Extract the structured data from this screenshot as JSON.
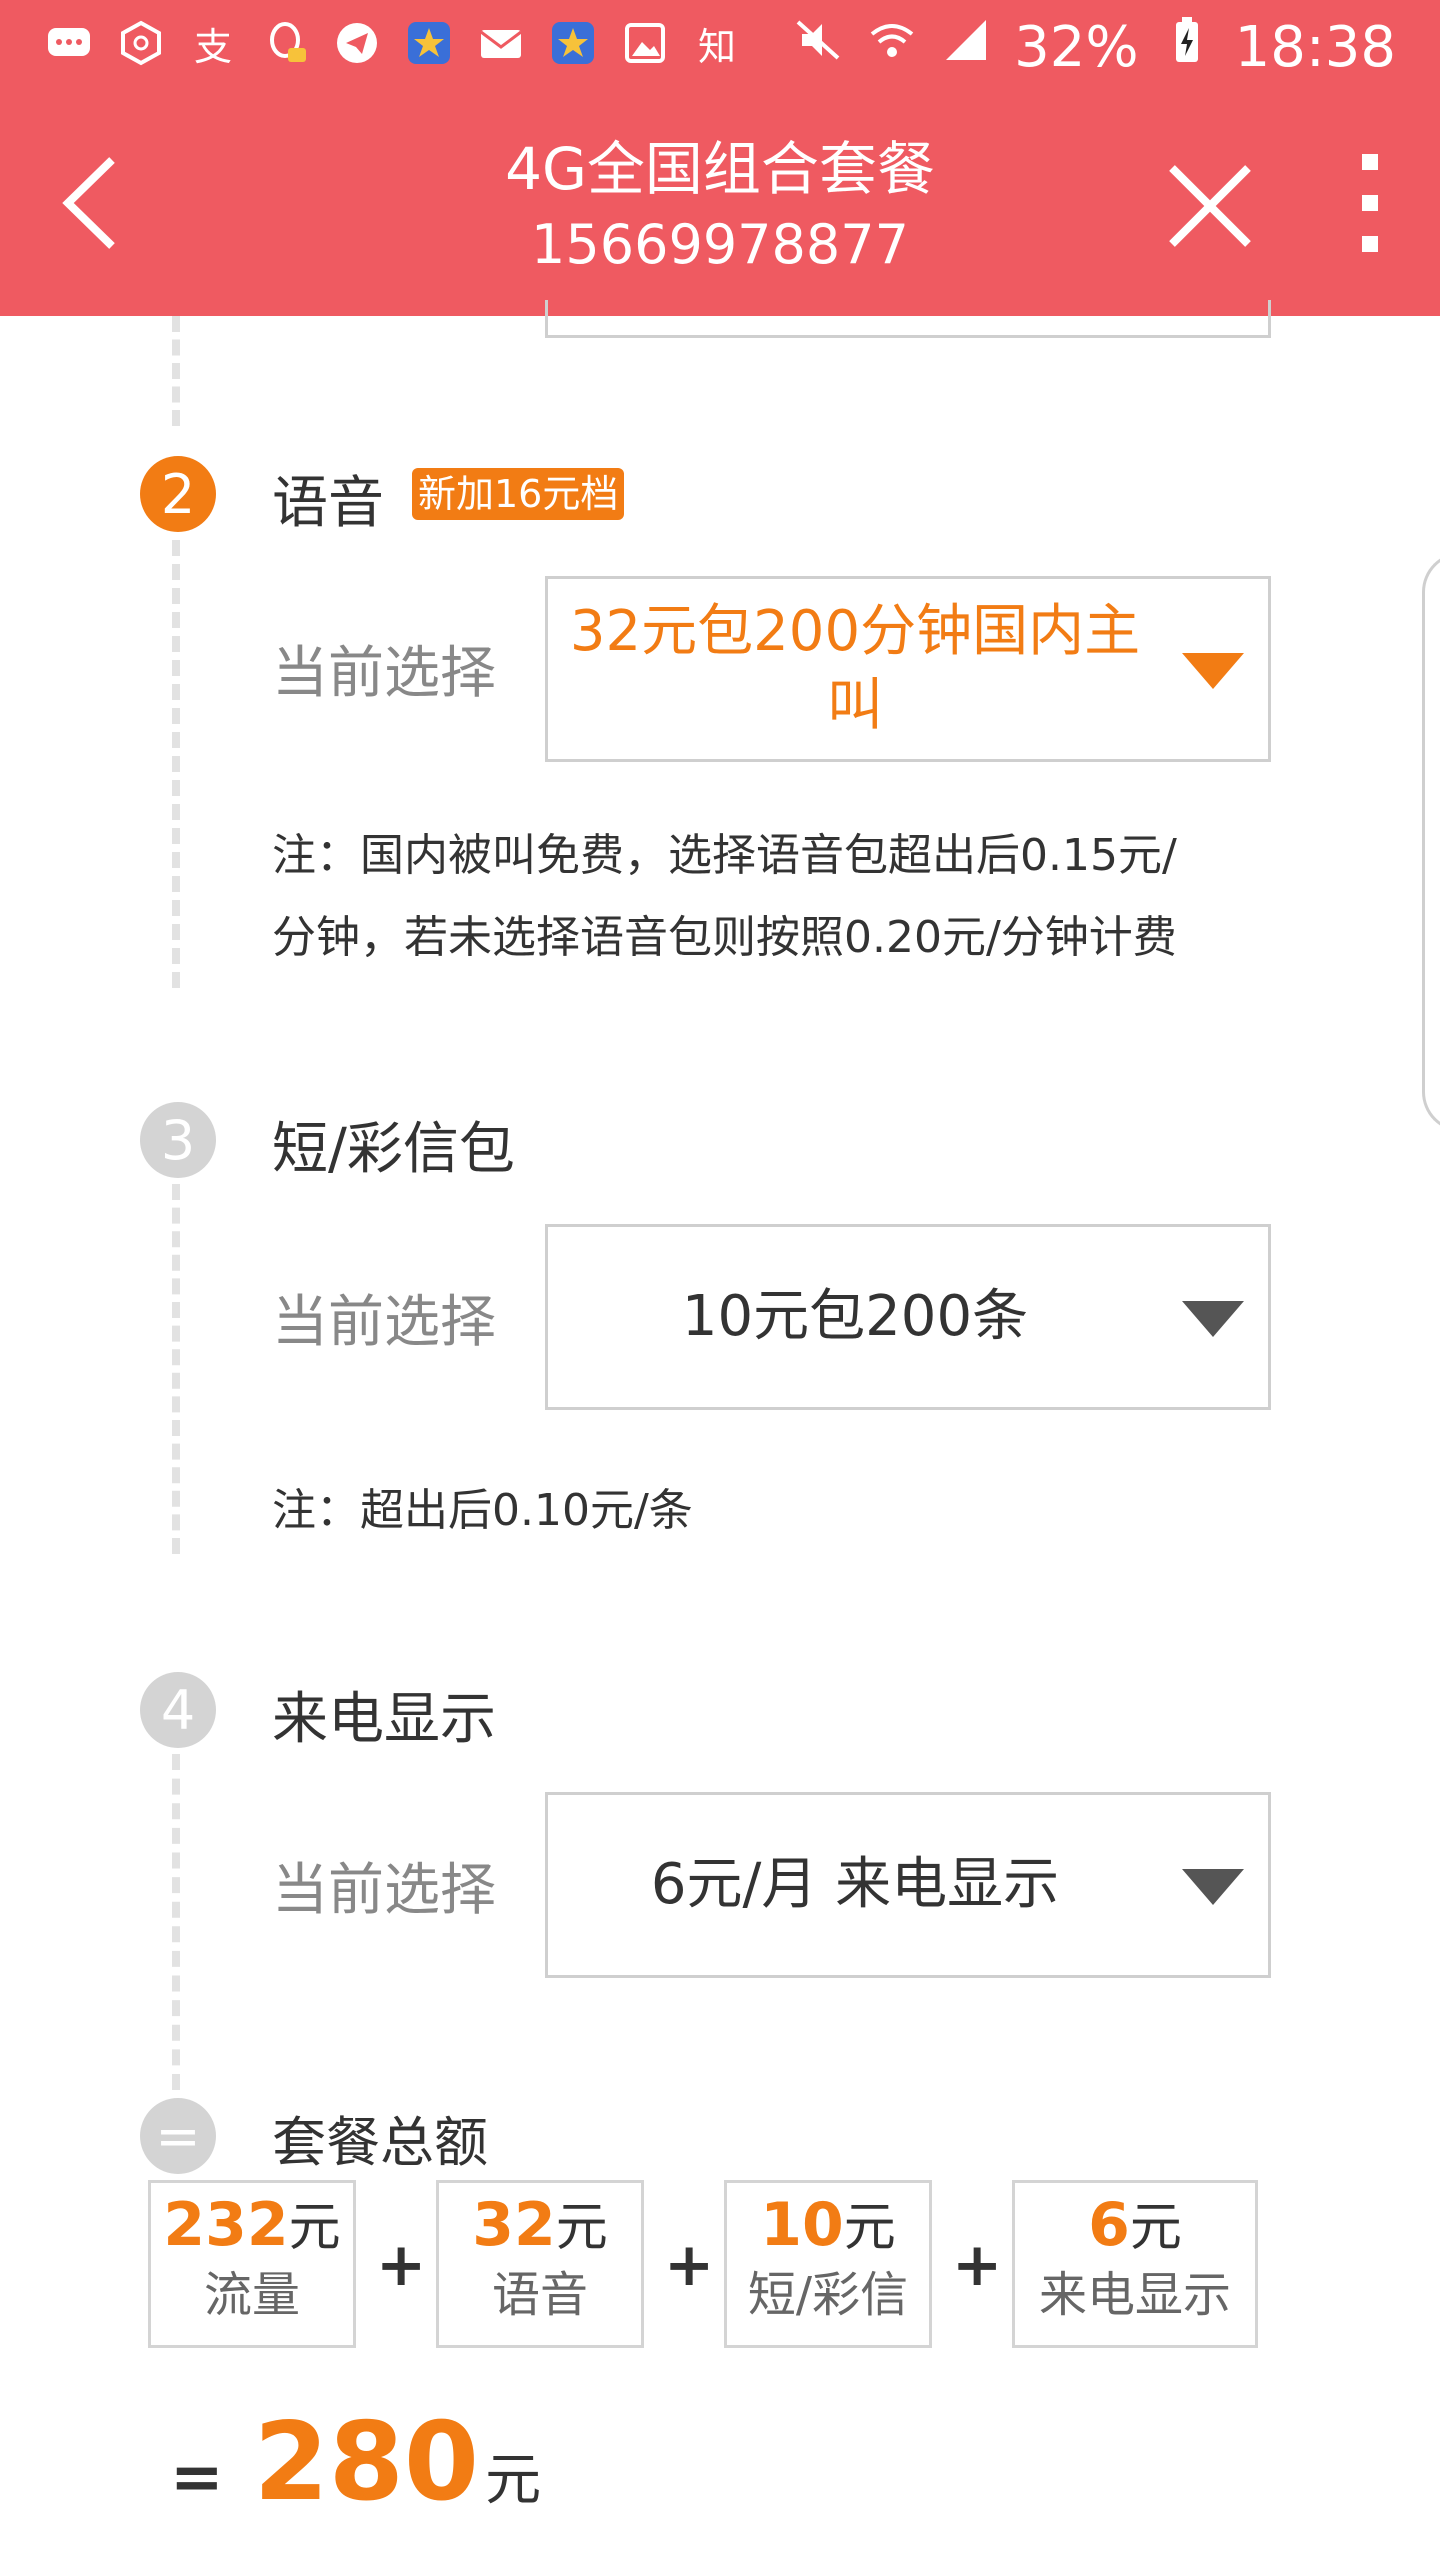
{
  "status_bar": {
    "battery": "32%",
    "time": "18:38",
    "icons": [
      "message-icon",
      "hexagon-app-icon",
      "alipay-icon",
      "qq-icon",
      "telegram-icon",
      "star-app-icon",
      "mail-icon",
      "star-app-icon",
      "image-icon",
      "zhihu-icon"
    ],
    "zhi_label": "知",
    "alipay_label": "支"
  },
  "header": {
    "title": "4G全国组合套餐",
    "phone": "15669978877"
  },
  "sections": {
    "voice": {
      "number": "2",
      "title": "语音",
      "badge": "新加16元档",
      "current_label": "当前选择",
      "selected": "32元包200分钟国内主叫",
      "note_line1": "注：国内被叫免费，选择语音包超出后0.15元/",
      "note_line2": "分钟，若未选择语音包则按照0.20元/分钟计费"
    },
    "sms": {
      "number": "3",
      "title": "短/彩信包",
      "current_label": "当前选择",
      "selected": "10元包200条",
      "note": "注：超出后0.10元/条"
    },
    "caller_id": {
      "number": "4",
      "title": "来电显示",
      "current_label": "当前选择",
      "selected": "6元/月 来电显示"
    }
  },
  "total": {
    "icon": "=",
    "label": "套餐总额",
    "items": [
      {
        "amount": "232",
        "unit": "元",
        "name": "流量"
      },
      {
        "amount": "32",
        "unit": "元",
        "name": "语音"
      },
      {
        "amount": "10",
        "unit": "元",
        "name": "短/彩信"
      },
      {
        "amount": "6",
        "unit": "元",
        "name": "来电显示"
      }
    ],
    "plus": "+",
    "equals": "=",
    "grand_amount": "280",
    "grand_unit": "元"
  },
  "colors": {
    "header_bg": "#ef5a61",
    "accent_orange": "#f27c14",
    "inactive_gray": "#d4d4d4"
  }
}
